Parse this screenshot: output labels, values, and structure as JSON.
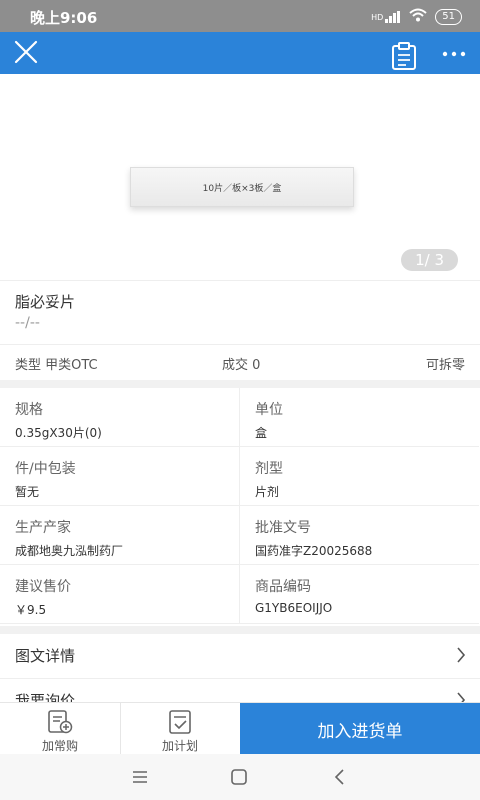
{
  "status": {
    "time": "晚上9:06",
    "signal_label": "HD",
    "battery": "51"
  },
  "header": {
    "close_icon": "close-icon",
    "clipboard_icon": "clipboard-icon",
    "more_icon": "more-icon"
  },
  "gallery": {
    "box_label": "10片／板×3板／盒",
    "counter": "1/ 3"
  },
  "product": {
    "name": "脂必妥片",
    "subtitle": "--/--"
  },
  "meta": {
    "type": "类型 甲类OTC",
    "deals": "成交 0",
    "split": "可拆零"
  },
  "details": [
    {
      "label": "规格",
      "value": "0.35gX30片(0)"
    },
    {
      "label": "单位",
      "value": "盒"
    },
    {
      "label": "件/中包装",
      "value": "暂无"
    },
    {
      "label": "剂型",
      "value": "片剂"
    },
    {
      "label": "生产产家",
      "value": "成都地奥九泓制药厂"
    },
    {
      "label": "批准文号",
      "value": "国药准字Z20025688"
    },
    {
      "label": "建议售价",
      "value": "￥9.5"
    },
    {
      "label": "商品编码",
      "value": "G1YB6EOIJJO"
    }
  ],
  "links": [
    {
      "label": "图文详情"
    },
    {
      "label": "我要询价"
    }
  ],
  "bottom": {
    "add_common": "加常购",
    "add_plan": "加计划",
    "add_cart": "加入进货单"
  }
}
